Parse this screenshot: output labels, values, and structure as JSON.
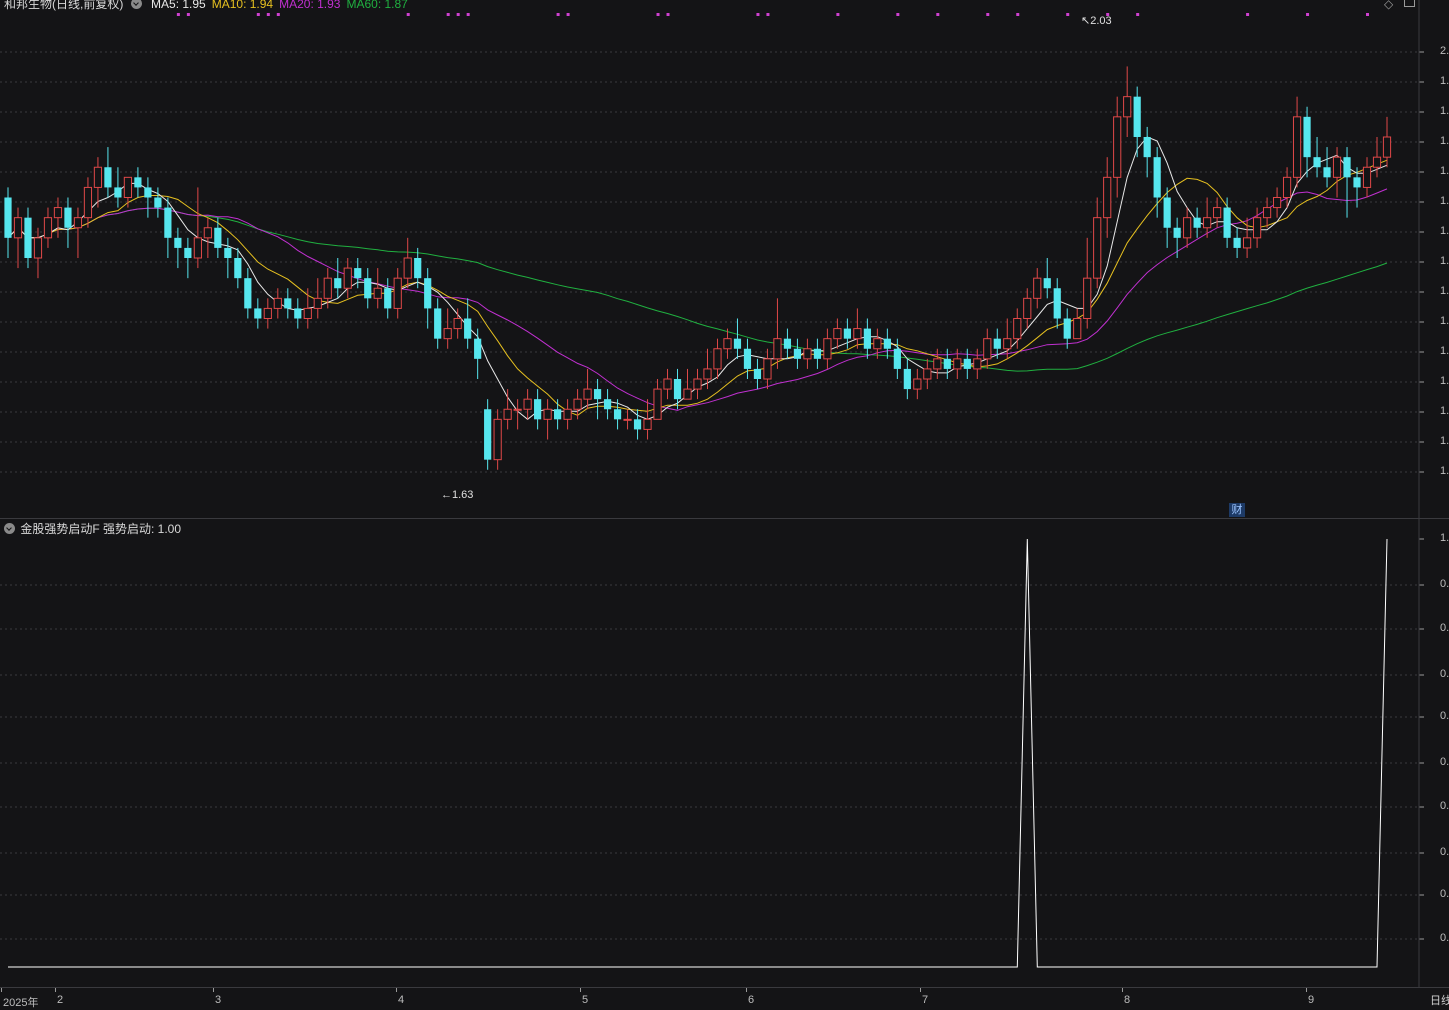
{
  "title_bar": {
    "stock_label": "和邦生物(日线,前复权)",
    "ma_indicators": [
      {
        "label": "MA5: 1.95",
        "color": "#e8e8e8"
      },
      {
        "label": "MA10: 1.94",
        "color": "#e6c020"
      },
      {
        "label": "MA20: 1.93",
        "color": "#c030d0"
      },
      {
        "label": "MA60: 1.87",
        "color": "#20b040"
      }
    ]
  },
  "colors": {
    "up": "#e04848",
    "down": "#56e6ee",
    "ma5": "#e8e8e8",
    "ma10": "#e6c020",
    "ma20": "#c030d0",
    "ma60": "#20b040",
    "signal_dots": "#d040d0",
    "indicator_line": "#ffffff",
    "grid": "#3a3a3e"
  },
  "annotations": {
    "high_label": "2.03",
    "low_label": "1.63",
    "fin_badge": "财"
  },
  "price_axis_labels": [
    "2.",
    "1.",
    "1.",
    "1.",
    "1.",
    "1.",
    "1.",
    "1.",
    "1.",
    "1.",
    "1.",
    "1.",
    "1.",
    "1.",
    "1."
  ],
  "indicator_panel": {
    "label": "金股强势启动F 强势启动: 1.00",
    "axis_labels": [
      "1.",
      "0.",
      "0.",
      "0.",
      "0.",
      "0.",
      "0.",
      "0.",
      "0.",
      "0."
    ]
  },
  "time_axis": {
    "labels": [
      {
        "text": "2025年",
        "month": "2025-01"
      },
      {
        "text": "2",
        "month": "2025-02"
      },
      {
        "text": "3",
        "month": "2025-03"
      },
      {
        "text": "4",
        "month": "2025-04"
      },
      {
        "text": "5",
        "month": "2025-05"
      },
      {
        "text": "6",
        "month": "2025-06"
      },
      {
        "text": "7",
        "month": "2025-07"
      },
      {
        "text": "8",
        "month": "2025-08"
      },
      {
        "text": "9",
        "month": "2025-09"
      }
    ],
    "period_button": "日线"
  },
  "corner_icons": [
    "diamond-icon",
    "restore-icon"
  ],
  "chart_data": [
    {
      "type": "candlestick",
      "title": "和邦生物(日线,前复权)",
      "ylim": [
        1.6,
        2.08
      ],
      "marked_high": 2.03,
      "marked_low": 1.63,
      "candles": [
        [
          1.9,
          1.86,
          1.91,
          1.84
        ],
        [
          1.86,
          1.88,
          1.89,
          1.83
        ],
        [
          1.88,
          1.84,
          1.89,
          1.83
        ],
        [
          1.84,
          1.86,
          1.87,
          1.82
        ],
        [
          1.86,
          1.88,
          1.89,
          1.85
        ],
        [
          1.88,
          1.89,
          1.9,
          1.86
        ],
        [
          1.89,
          1.87,
          1.9,
          1.85
        ],
        [
          1.87,
          1.88,
          1.89,
          1.84
        ],
        [
          1.88,
          1.91,
          1.92,
          1.87
        ],
        [
          1.91,
          1.93,
          1.94,
          1.89
        ],
        [
          1.93,
          1.91,
          1.95,
          1.9
        ],
        [
          1.91,
          1.9,
          1.93,
          1.89
        ],
        [
          1.9,
          1.92,
          1.92,
          1.89
        ],
        [
          1.92,
          1.91,
          1.93,
          1.9
        ],
        [
          1.91,
          1.9,
          1.92,
          1.88
        ],
        [
          1.9,
          1.89,
          1.91,
          1.88
        ],
        [
          1.89,
          1.86,
          1.9,
          1.84
        ],
        [
          1.86,
          1.85,
          1.87,
          1.83
        ],
        [
          1.85,
          1.84,
          1.86,
          1.82
        ],
        [
          1.84,
          1.86,
          1.91,
          1.83
        ],
        [
          1.86,
          1.87,
          1.88,
          1.84
        ],
        [
          1.87,
          1.85,
          1.88,
          1.84
        ],
        [
          1.85,
          1.84,
          1.86,
          1.82
        ],
        [
          1.84,
          1.82,
          1.85,
          1.81
        ],
        [
          1.82,
          1.79,
          1.83,
          1.78
        ],
        [
          1.79,
          1.78,
          1.8,
          1.77
        ],
        [
          1.78,
          1.79,
          1.8,
          1.77
        ],
        [
          1.79,
          1.8,
          1.81,
          1.78
        ],
        [
          1.8,
          1.79,
          1.81,
          1.78
        ],
        [
          1.79,
          1.78,
          1.8,
          1.77
        ],
        [
          1.78,
          1.79,
          1.81,
          1.77
        ],
        [
          1.79,
          1.8,
          1.82,
          1.78
        ],
        [
          1.8,
          1.82,
          1.83,
          1.79
        ],
        [
          1.82,
          1.81,
          1.84,
          1.8
        ],
        [
          1.81,
          1.83,
          1.84,
          1.8
        ],
        [
          1.83,
          1.82,
          1.84,
          1.81
        ],
        [
          1.82,
          1.8,
          1.83,
          1.79
        ],
        [
          1.8,
          1.81,
          1.83,
          1.79
        ],
        [
          1.81,
          1.79,
          1.82,
          1.78
        ],
        [
          1.79,
          1.82,
          1.83,
          1.78
        ],
        [
          1.82,
          1.84,
          1.86,
          1.81
        ],
        [
          1.84,
          1.82,
          1.85,
          1.81
        ],
        [
          1.82,
          1.79,
          1.83,
          1.77
        ],
        [
          1.79,
          1.76,
          1.8,
          1.75
        ],
        [
          1.76,
          1.77,
          1.79,
          1.75
        ],
        [
          1.77,
          1.78,
          1.79,
          1.76
        ],
        [
          1.78,
          1.76,
          1.8,
          1.75
        ],
        [
          1.76,
          1.74,
          1.77,
          1.72
        ],
        [
          1.69,
          1.64,
          1.7,
          1.63
        ],
        [
          1.64,
          1.68,
          1.69,
          1.63
        ],
        [
          1.68,
          1.69,
          1.71,
          1.67
        ],
        [
          1.69,
          1.69,
          1.7,
          1.67
        ],
        [
          1.69,
          1.7,
          1.71,
          1.68
        ],
        [
          1.7,
          1.68,
          1.71,
          1.67
        ],
        [
          1.68,
          1.69,
          1.7,
          1.66
        ],
        [
          1.69,
          1.68,
          1.7,
          1.67
        ],
        [
          1.68,
          1.69,
          1.7,
          1.67
        ],
        [
          1.69,
          1.7,
          1.71,
          1.68
        ],
        [
          1.7,
          1.71,
          1.73,
          1.69
        ],
        [
          1.71,
          1.7,
          1.72,
          1.68
        ],
        [
          1.7,
          1.69,
          1.71,
          1.68
        ],
        [
          1.69,
          1.68,
          1.7,
          1.67
        ],
        [
          1.68,
          1.68,
          1.69,
          1.67
        ],
        [
          1.68,
          1.67,
          1.69,
          1.66
        ],
        [
          1.67,
          1.68,
          1.7,
          1.66
        ],
        [
          1.68,
          1.71,
          1.72,
          1.68
        ],
        [
          1.71,
          1.72,
          1.73,
          1.7
        ],
        [
          1.72,
          1.7,
          1.73,
          1.69
        ],
        [
          1.7,
          1.71,
          1.73,
          1.7
        ],
        [
          1.71,
          1.72,
          1.73,
          1.7
        ],
        [
          1.72,
          1.73,
          1.75,
          1.71
        ],
        [
          1.73,
          1.75,
          1.76,
          1.72
        ],
        [
          1.75,
          1.76,
          1.77,
          1.74
        ],
        [
          1.76,
          1.75,
          1.78,
          1.74
        ],
        [
          1.75,
          1.73,
          1.76,
          1.72
        ],
        [
          1.73,
          1.72,
          1.74,
          1.71
        ],
        [
          1.72,
          1.74,
          1.75,
          1.71
        ],
        [
          1.74,
          1.76,
          1.8,
          1.73
        ],
        [
          1.76,
          1.75,
          1.77,
          1.74
        ],
        [
          1.75,
          1.74,
          1.76,
          1.73
        ],
        [
          1.74,
          1.75,
          1.76,
          1.73
        ],
        [
          1.75,
          1.74,
          1.76,
          1.73
        ],
        [
          1.74,
          1.76,
          1.77,
          1.73
        ],
        [
          1.76,
          1.77,
          1.78,
          1.75
        ],
        [
          1.77,
          1.76,
          1.78,
          1.75
        ],
        [
          1.76,
          1.77,
          1.79,
          1.75
        ],
        [
          1.77,
          1.75,
          1.78,
          1.74
        ],
        [
          1.75,
          1.76,
          1.77,
          1.74
        ],
        [
          1.76,
          1.75,
          1.77,
          1.74
        ],
        [
          1.75,
          1.73,
          1.76,
          1.72
        ],
        [
          1.73,
          1.71,
          1.74,
          1.7
        ],
        [
          1.71,
          1.72,
          1.73,
          1.7
        ],
        [
          1.72,
          1.73,
          1.74,
          1.71
        ],
        [
          1.73,
          1.74,
          1.75,
          1.72
        ],
        [
          1.74,
          1.73,
          1.75,
          1.72
        ],
        [
          1.73,
          1.74,
          1.75,
          1.72
        ],
        [
          1.74,
          1.73,
          1.75,
          1.72
        ],
        [
          1.73,
          1.74,
          1.75,
          1.72
        ],
        [
          1.74,
          1.76,
          1.77,
          1.73
        ],
        [
          1.76,
          1.75,
          1.77,
          1.74
        ],
        [
          1.75,
          1.76,
          1.78,
          1.74
        ],
        [
          1.76,
          1.78,
          1.79,
          1.75
        ],
        [
          1.78,
          1.8,
          1.81,
          1.77
        ],
        [
          1.8,
          1.82,
          1.83,
          1.79
        ],
        [
          1.82,
          1.81,
          1.84,
          1.8
        ],
        [
          1.81,
          1.78,
          1.82,
          1.77
        ],
        [
          1.78,
          1.76,
          1.79,
          1.75
        ],
        [
          1.76,
          1.78,
          1.79,
          1.76
        ],
        [
          1.78,
          1.82,
          1.86,
          1.77
        ],
        [
          1.82,
          1.88,
          1.9,
          1.81
        ],
        [
          1.88,
          1.92,
          1.94,
          1.86
        ],
        [
          1.92,
          1.98,
          2.0,
          1.9
        ],
        [
          1.98,
          2.0,
          2.03,
          1.96
        ],
        [
          2.0,
          1.96,
          2.01,
          1.94
        ],
        [
          1.96,
          1.94,
          1.97,
          1.92
        ],
        [
          1.94,
          1.9,
          1.95,
          1.88
        ],
        [
          1.9,
          1.87,
          1.91,
          1.85
        ],
        [
          1.87,
          1.86,
          1.88,
          1.84
        ],
        [
          1.86,
          1.88,
          1.89,
          1.85
        ],
        [
          1.88,
          1.87,
          1.89,
          1.86
        ],
        [
          1.87,
          1.88,
          1.9,
          1.86
        ],
        [
          1.88,
          1.89,
          1.9,
          1.87
        ],
        [
          1.89,
          1.86,
          1.9,
          1.85
        ],
        [
          1.86,
          1.85,
          1.87,
          1.84
        ],
        [
          1.85,
          1.86,
          1.88,
          1.84
        ],
        [
          1.86,
          1.88,
          1.89,
          1.85
        ],
        [
          1.88,
          1.89,
          1.9,
          1.87
        ],
        [
          1.89,
          1.9,
          1.91,
          1.88
        ],
        [
          1.9,
          1.92,
          1.93,
          1.89
        ],
        [
          1.92,
          1.98,
          2.0,
          1.91
        ],
        [
          1.98,
          1.94,
          1.99,
          1.92
        ],
        [
          1.94,
          1.93,
          1.96,
          1.92
        ],
        [
          1.93,
          1.92,
          1.95,
          1.91
        ],
        [
          1.92,
          1.94,
          1.95,
          1.9
        ],
        [
          1.94,
          1.92,
          1.95,
          1.88
        ],
        [
          1.92,
          1.91,
          1.93,
          1.89
        ],
        [
          1.91,
          1.93,
          1.94,
          1.9
        ],
        [
          1.93,
          1.94,
          1.96,
          1.92
        ],
        [
          1.94,
          1.96,
          1.98,
          1.93
        ]
      ]
    },
    {
      "type": "line",
      "title": "金股强势启动F 强势启动: 1.00",
      "ylim": [
        0,
        1
      ],
      "n": 139,
      "spikes": [
        {
          "index": 102,
          "value": 1
        },
        {
          "index": 138,
          "value": 1
        }
      ]
    }
  ]
}
